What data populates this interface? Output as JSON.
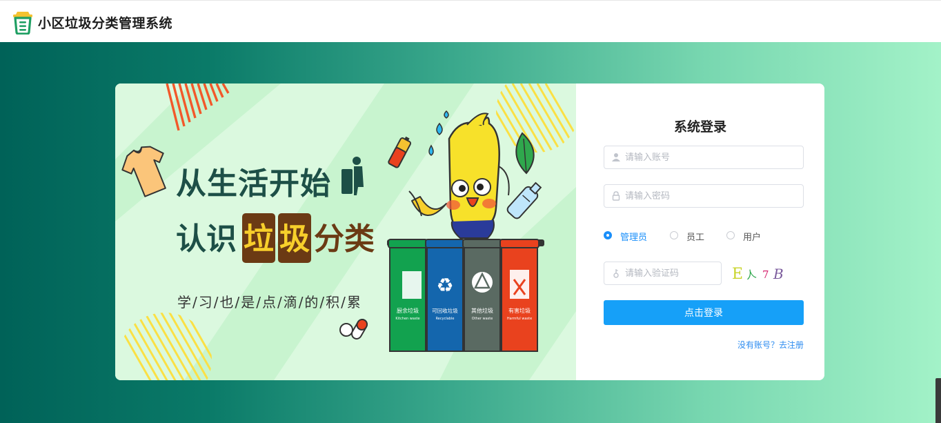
{
  "header": {
    "title": "小区垃圾分类管理系统",
    "logo_icon": "trash-can-logo-icon"
  },
  "banner": {
    "headline_line1": "从生活开始",
    "headline_line2_prefix": "认识",
    "headline_line2_boxed": [
      "垃",
      "圾"
    ],
    "headline_line2_suffix": "分类",
    "slogan": "学/习/也/是/点/滴/的/积/累",
    "bins": [
      {
        "cn": "厨余垃圾",
        "en": "Kitchen waste",
        "color": "#12a24f",
        "icon": "food-waste-icon"
      },
      {
        "cn": "可回收垃圾",
        "en": "Recyclable",
        "color": "#1466ad",
        "icon": "recycle-icon"
      },
      {
        "cn": "其他垃圾",
        "en": "Other waste",
        "color": "#5a6a62",
        "icon": "other-waste-icon"
      },
      {
        "cn": "有害垃圾",
        "en": "Harmful waste",
        "color": "#e9421e",
        "icon": "harmful-waste-icon"
      }
    ],
    "colors": {
      "background": "#dbf9df",
      "stripe": "#c6f3cc",
      "headline": "#1d4f47",
      "boxed": "#6b3a14"
    }
  },
  "login": {
    "title": "系统登录",
    "account_placeholder": "请输入账号",
    "password_placeholder": "请输入密码",
    "captcha_placeholder": "请输入验证码",
    "roles": [
      {
        "label": "管理员",
        "selected": true
      },
      {
        "label": "员工",
        "selected": false
      },
      {
        "label": "用户",
        "selected": false
      }
    ],
    "captcha_chars": [
      "E",
      "人",
      "7",
      "B"
    ],
    "submit_label": "点击登录",
    "register_link": "没有账号？去注册",
    "accent_color": "#16a0f8"
  }
}
